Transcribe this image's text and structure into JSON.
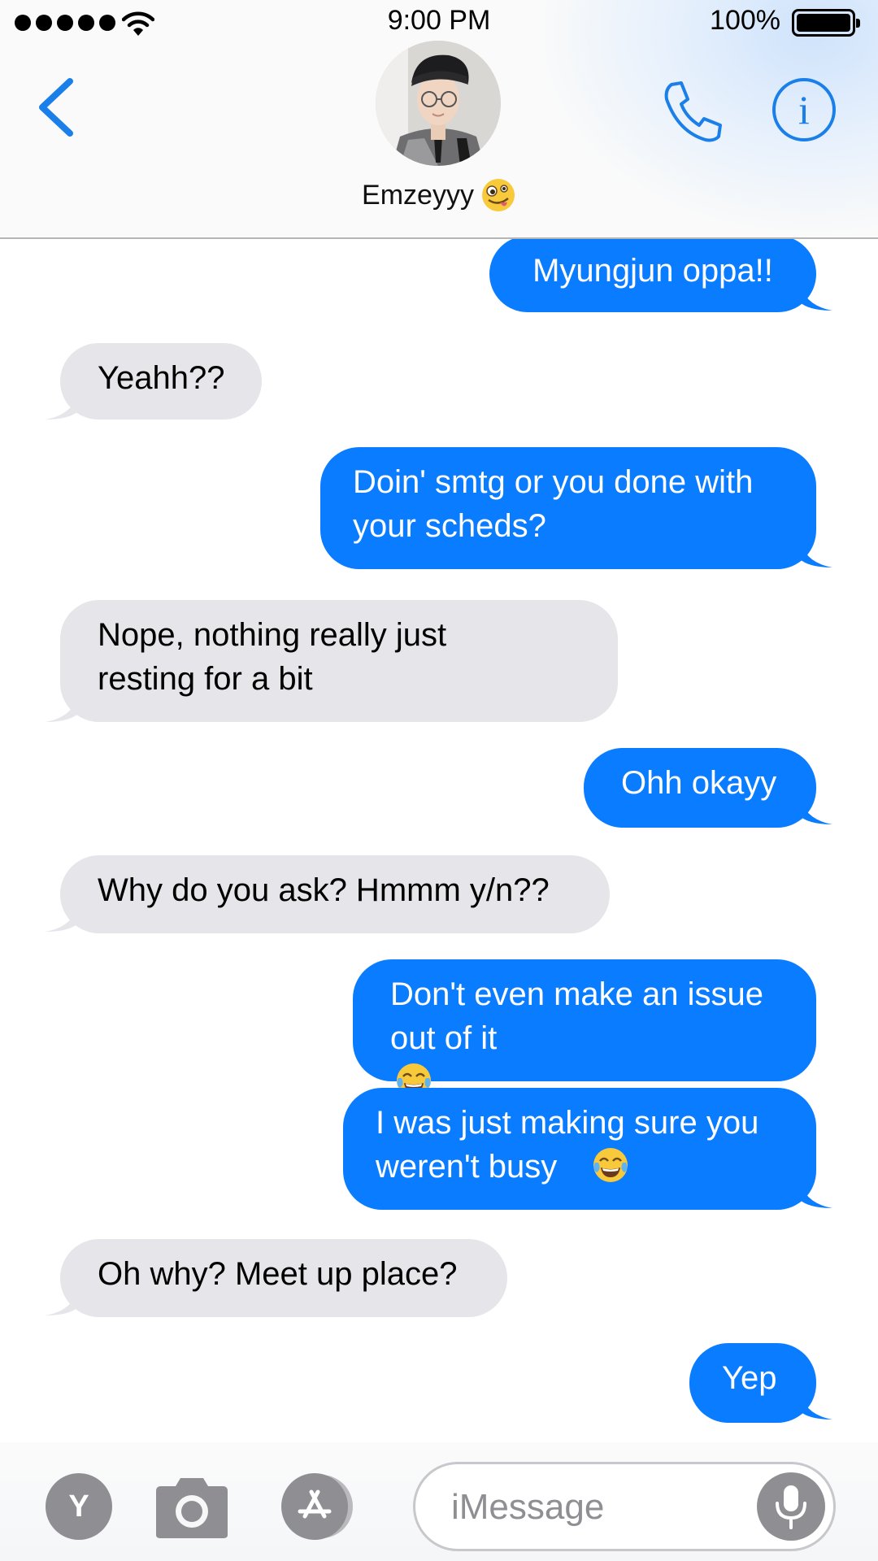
{
  "status_bar": {
    "time": "9:00 PM",
    "battery_percent": "100%",
    "signal_bars": 5
  },
  "header": {
    "contact_name": "Emzeyyy",
    "contact_emoji": "zany-face-emoji",
    "back_icon": "chevron-left-icon",
    "call_icon": "phone-icon",
    "info_icon": "info-icon",
    "info_glyph": "i"
  },
  "messages": [
    {
      "direction": "outgoing",
      "text": "Myungjun oppa!!"
    },
    {
      "direction": "incoming",
      "text": "Yeahh??"
    },
    {
      "direction": "outgoing",
      "text": "Doin' smtg or you done with your scheds?"
    },
    {
      "direction": "incoming",
      "text": "Nope, nothing really just resting for a bit"
    },
    {
      "direction": "outgoing",
      "text": "Ohh okayy"
    },
    {
      "direction": "incoming",
      "text": "Why do you ask? Hmmm y/n??"
    },
    {
      "direction": "outgoing",
      "text": "Don't even make an issue out of it",
      "emoji": "tears-of-joy-emoji"
    },
    {
      "direction": "outgoing",
      "text": "I was just making sure you weren't busy",
      "emoji": "tears-of-joy-emoji"
    },
    {
      "direction": "incoming",
      "text": "Oh why? Meet up place?"
    },
    {
      "direction": "outgoing",
      "text": "Yep"
    }
  ],
  "input_bar": {
    "y_button_label": "Y",
    "camera_icon": "camera-icon",
    "apps_icon": "app-store-icon",
    "placeholder": "iMessage",
    "mic_icon": "microphone-icon"
  },
  "colors": {
    "outgoing_bubble": "#0a7cff",
    "incoming_bubble": "#e5e5ea",
    "accent": "#1a7fe9",
    "icon_gray": "#8e8e93"
  }
}
